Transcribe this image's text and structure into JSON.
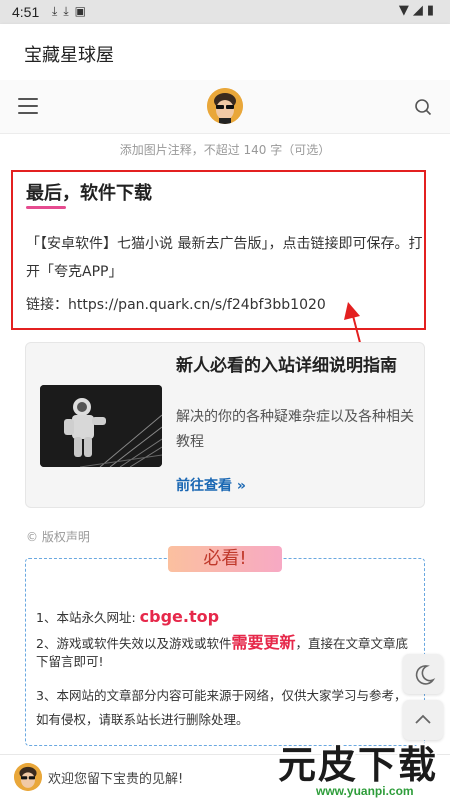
{
  "statusbar": {
    "time": "4:51",
    "icons": [
      "download-icon",
      "download-icon",
      "app-a-icon"
    ],
    "right_icons": [
      "wifi-icon",
      "signal-icon",
      "battery-icon"
    ]
  },
  "appbar": {
    "title": "宝藏星球屋"
  },
  "header": {
    "menu_icon": "menu-icon",
    "logo": "avatar-logo",
    "search_icon": "search-icon"
  },
  "article": {
    "caption": "添加图片注释，不超过 140 字（可选）",
    "heading": "最后，软件下载",
    "paragraph": "「【安卓软件】七猫小说 最新去广告版」，点击链接即可保存。打开「夸克APP」",
    "link": "链接：https://pan.quark.cn/s/f24bf3bb1020"
  },
  "card": {
    "title": "新人必看的入站详细说明指南",
    "desc": "解决的你的各种疑难杂症以及各种相关教程",
    "link": "前往查看 »"
  },
  "copyright": "© 版权声明",
  "notice": {
    "badge": "必看!",
    "line1_prefix": "1、本站永久网址: ",
    "line1_url": "cbge.top",
    "line2_prefix": "2、游戏或软件失效以及游戏或软件",
    "line2_highlight": "需要更新",
    "line2_suffix": "，直接在文章文章底下留言即可!",
    "line3": "3、本网站的文章部分内容可能来源于网络，仅供大家学习与参考，如有侵权，请联系站长进行删除处理。"
  },
  "fab": {
    "theme_icon": "moon-icon",
    "top_icon": "chevron-up-icon"
  },
  "bottombar": {
    "comment_text": "欢迎您留下宝贵的见解!"
  },
  "watermark": {
    "big": "元皮下载",
    "url": "www.yuanpi.com"
  },
  "colors": {
    "highlight_box": "#e32020",
    "accent_pink": "#e64b8f",
    "link_blue": "#1a67b3",
    "notice_red": "#e6284a",
    "watermark_green": "#2e9d3a"
  }
}
